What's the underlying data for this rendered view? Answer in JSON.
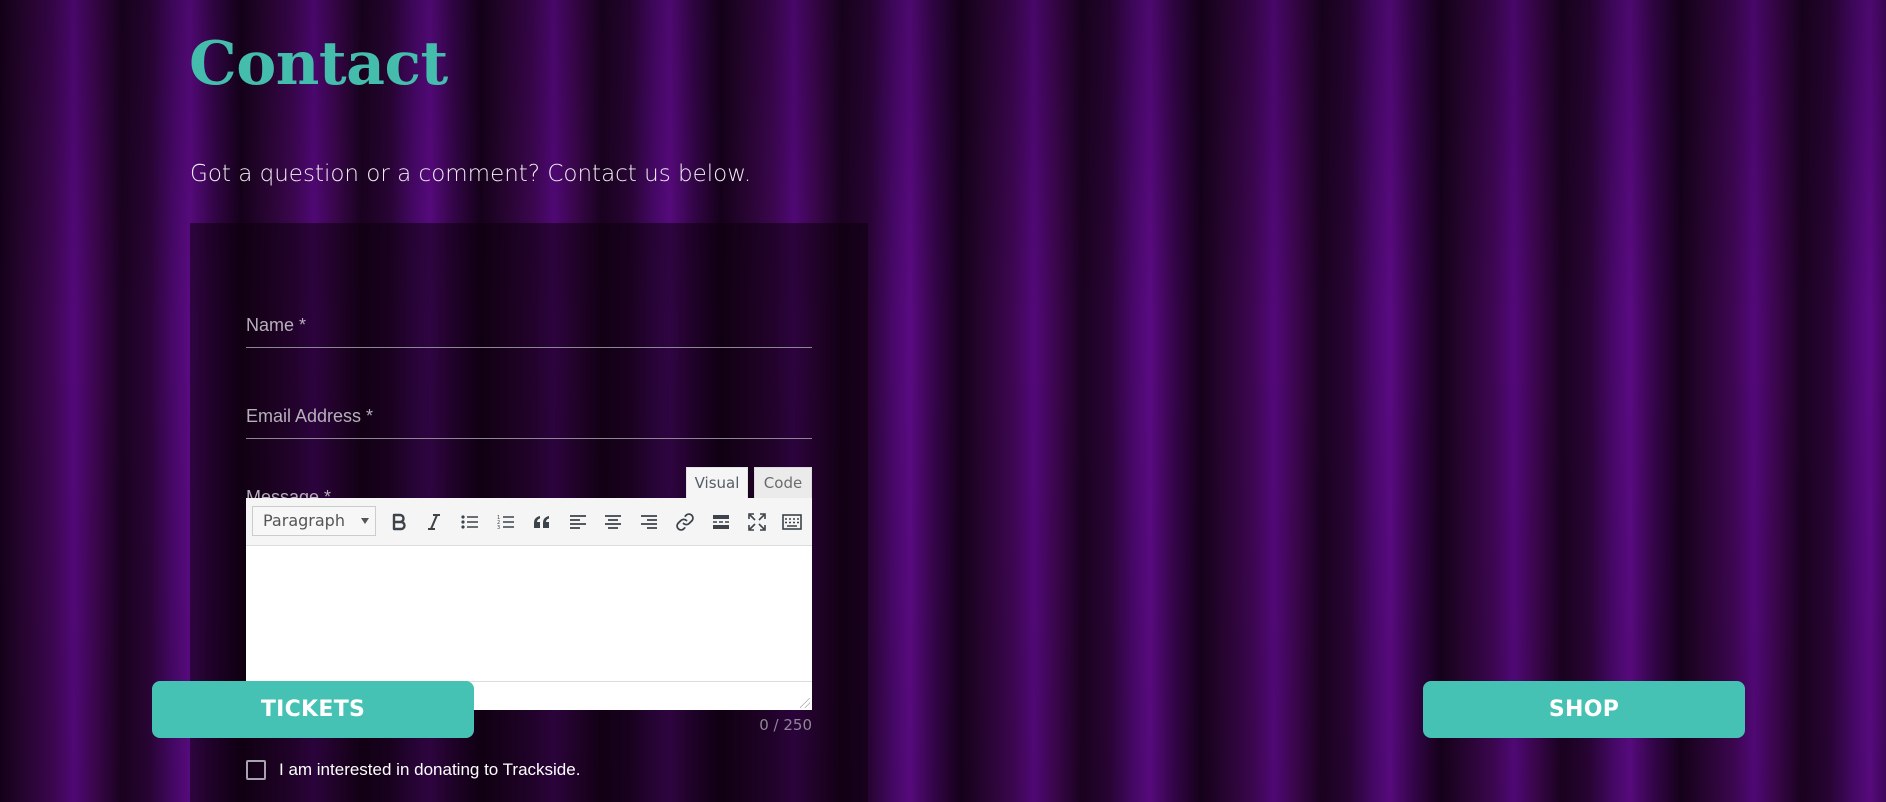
{
  "page": {
    "title": "Contact",
    "intro": "Got a question or a comment? Contact us below."
  },
  "form": {
    "name_placeholder": "Name *",
    "email_placeholder": "Email Address *",
    "message_label": "Message *",
    "editor": {
      "tab_visual": "Visual",
      "tab_code": "Code",
      "format_select_value": "Paragraph",
      "toolbar_icons": [
        "bold-icon",
        "italic-icon",
        "bulleted-list-icon",
        "numbered-list-icon",
        "blockquote-icon",
        "align-left-icon",
        "align-center-icon",
        "align-right-icon",
        "link-icon",
        "read-more-icon",
        "fullscreen-icon",
        "toolbar-toggle-icon"
      ]
    },
    "char_count": "0 / 250",
    "donate_label": "I am interested in donating to Trackside."
  },
  "cta": {
    "tickets_label": "TICKETS",
    "shop_label": "SHOP"
  },
  "colors": {
    "accent": "#45c2b3",
    "title": "#45bdad",
    "background": "#1d0224"
  }
}
